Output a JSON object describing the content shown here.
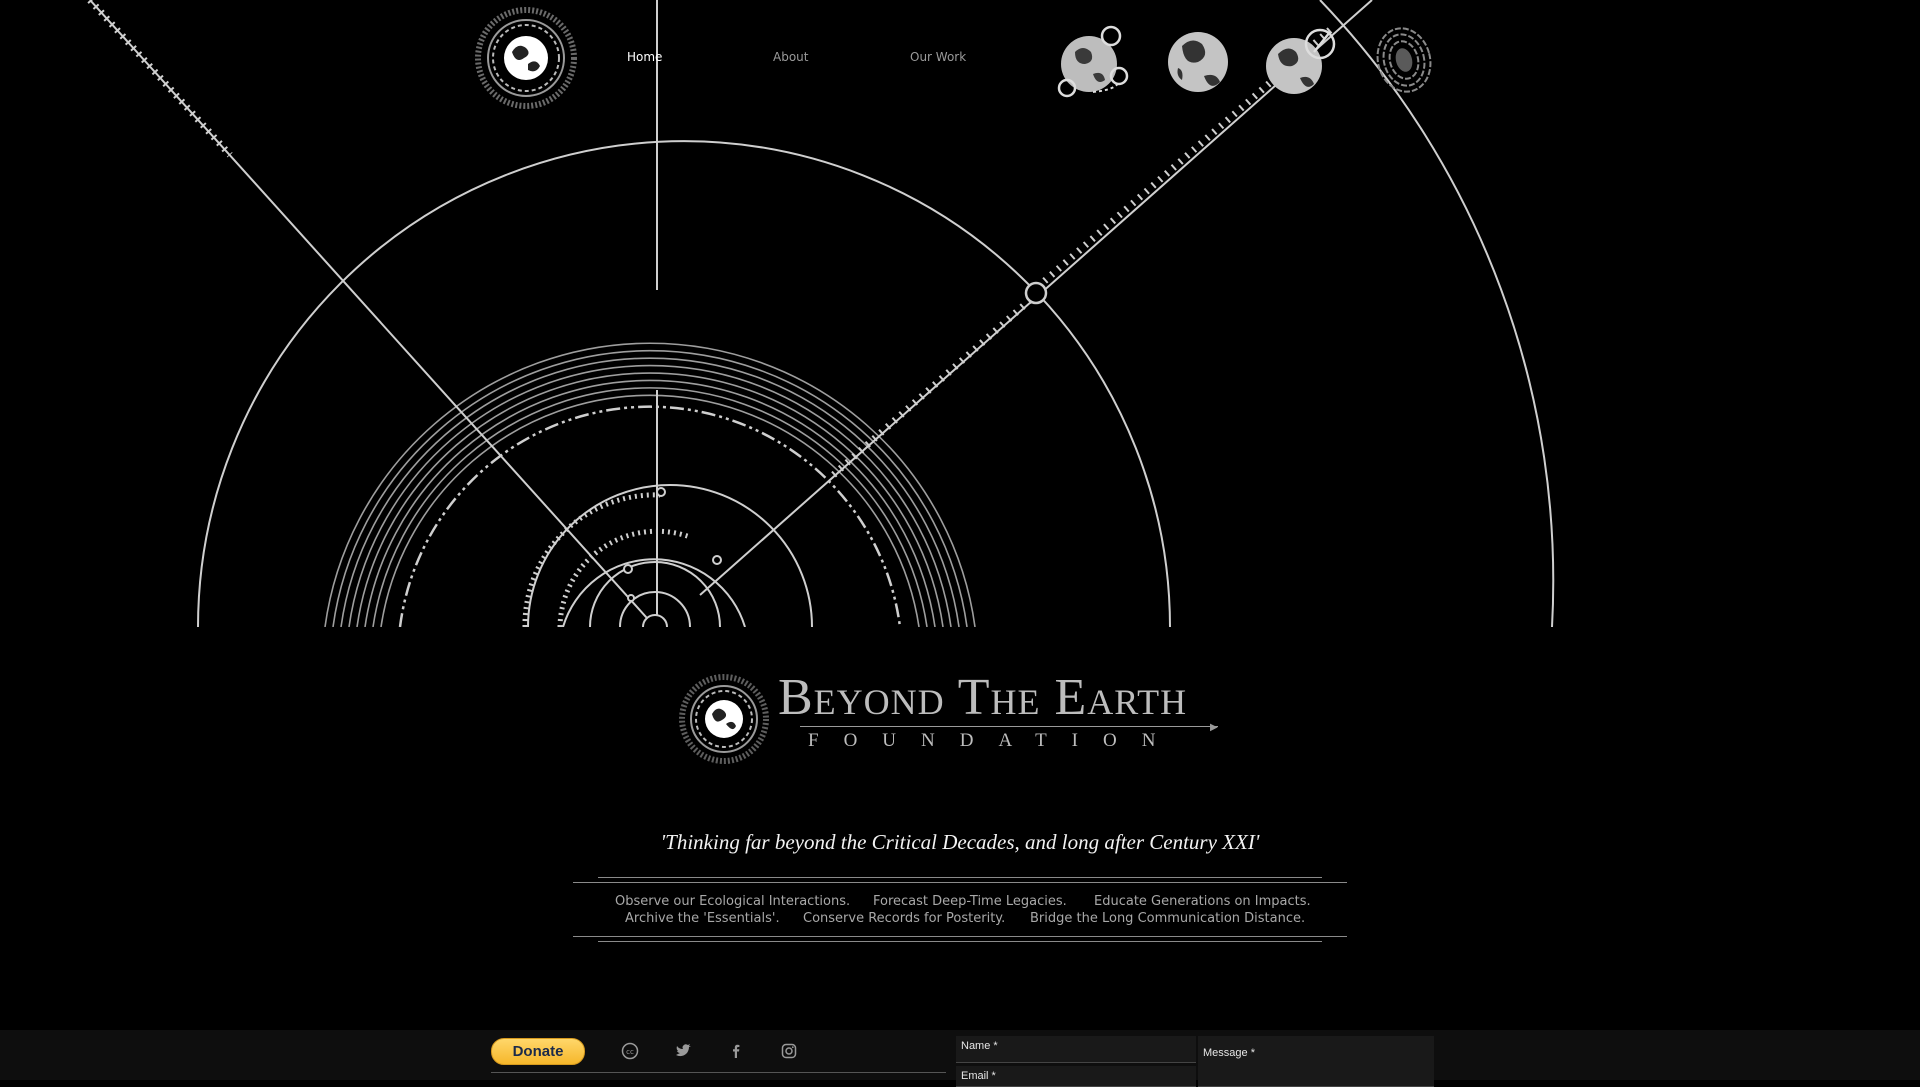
{
  "nav": {
    "items": [
      {
        "label": "Home",
        "active": true
      },
      {
        "label": "About",
        "active": false
      },
      {
        "label": "Our Work",
        "active": false
      }
    ],
    "globe_icons": [
      "globe-network-icon",
      "globe-icon",
      "globe-pen-icon",
      "globe-fingerprint-icon"
    ]
  },
  "brand": {
    "title": "Beyond The Earth",
    "subtitle": "FOUNDATION"
  },
  "tagline": "'Thinking far beyond the Critical Decades, and long after Century XXI'",
  "mission": {
    "row1": [
      "Observe our Ecological Interactions.",
      "Forecast Deep-Time Legacies.",
      "Educate Generations on Impacts."
    ],
    "row2": [
      "Archive the 'Essentials'.",
      "Conserve Records for Posterity.",
      "Bridge the Long Communication Distance."
    ]
  },
  "footer": {
    "donate_label": "Donate",
    "social_icons": [
      "creative-commons-icon",
      "twitter-icon",
      "facebook-icon",
      "instagram-icon"
    ],
    "form": {
      "name_label": "Name *",
      "email_label": "Email *",
      "message_label": "Message *"
    }
  },
  "colors": {
    "background": "#000000",
    "line": "#cfcfcf",
    "donate": "#f6b72b"
  }
}
